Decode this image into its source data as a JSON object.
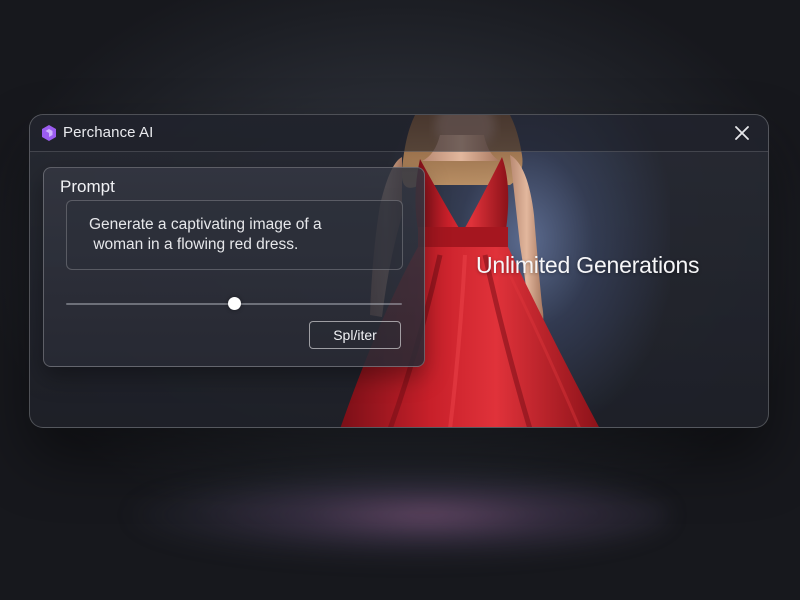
{
  "window": {
    "title": "Perchance AI",
    "logo_icon": "hexagon-logo-icon",
    "close_icon": "close-icon",
    "accent_color": "#9b5cf0"
  },
  "prompt_panel": {
    "heading": "Prompt",
    "prompt_text": "Generate a captivating image of a\n woman in a flowing red dress.",
    "slider_value": 0.5,
    "button_label": "Spl/iter"
  },
  "hero": {
    "caption": "Unlimited Generations",
    "dress_color": "#c8202a"
  }
}
